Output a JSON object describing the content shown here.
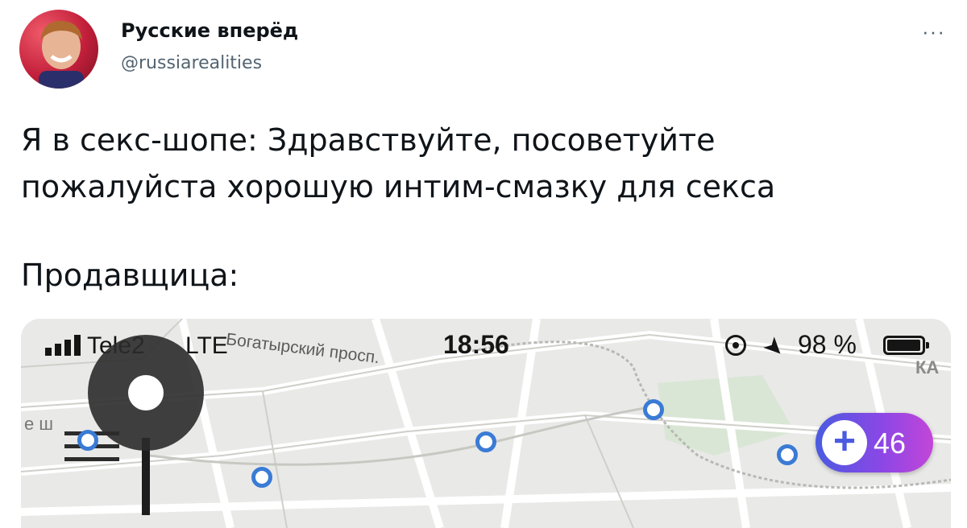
{
  "tweet": {
    "author_name": "Русские вперёд",
    "author_handle": "@russiarealities",
    "more_label": "···",
    "text_lines": [
      "Я в секс-шопе: Здравствуйте, посоветуйте",
      "пожалуйста хорошую интим-смазку для секса",
      "Продавщица:"
    ]
  },
  "media": {
    "status_bar": {
      "carrier": "Tele2",
      "network": "LTE",
      "time": "18:56",
      "battery": "98 %"
    },
    "map": {
      "street_label": "Богатырский просп.",
      "label_left": "е ш",
      "label_right": "КА"
    },
    "badge_count": "46",
    "badge_symbol": "+",
    "accent_colors": {
      "stop": "#3a7bd5",
      "badge_start": "#4a5be0",
      "badge_end": "#c346d8"
    },
    "icons": [
      "signal-icon",
      "location-lock-icon",
      "navigation-arrow-icon",
      "battery-icon",
      "menu-icon",
      "map-pin-icon",
      "plus-icon"
    ]
  }
}
